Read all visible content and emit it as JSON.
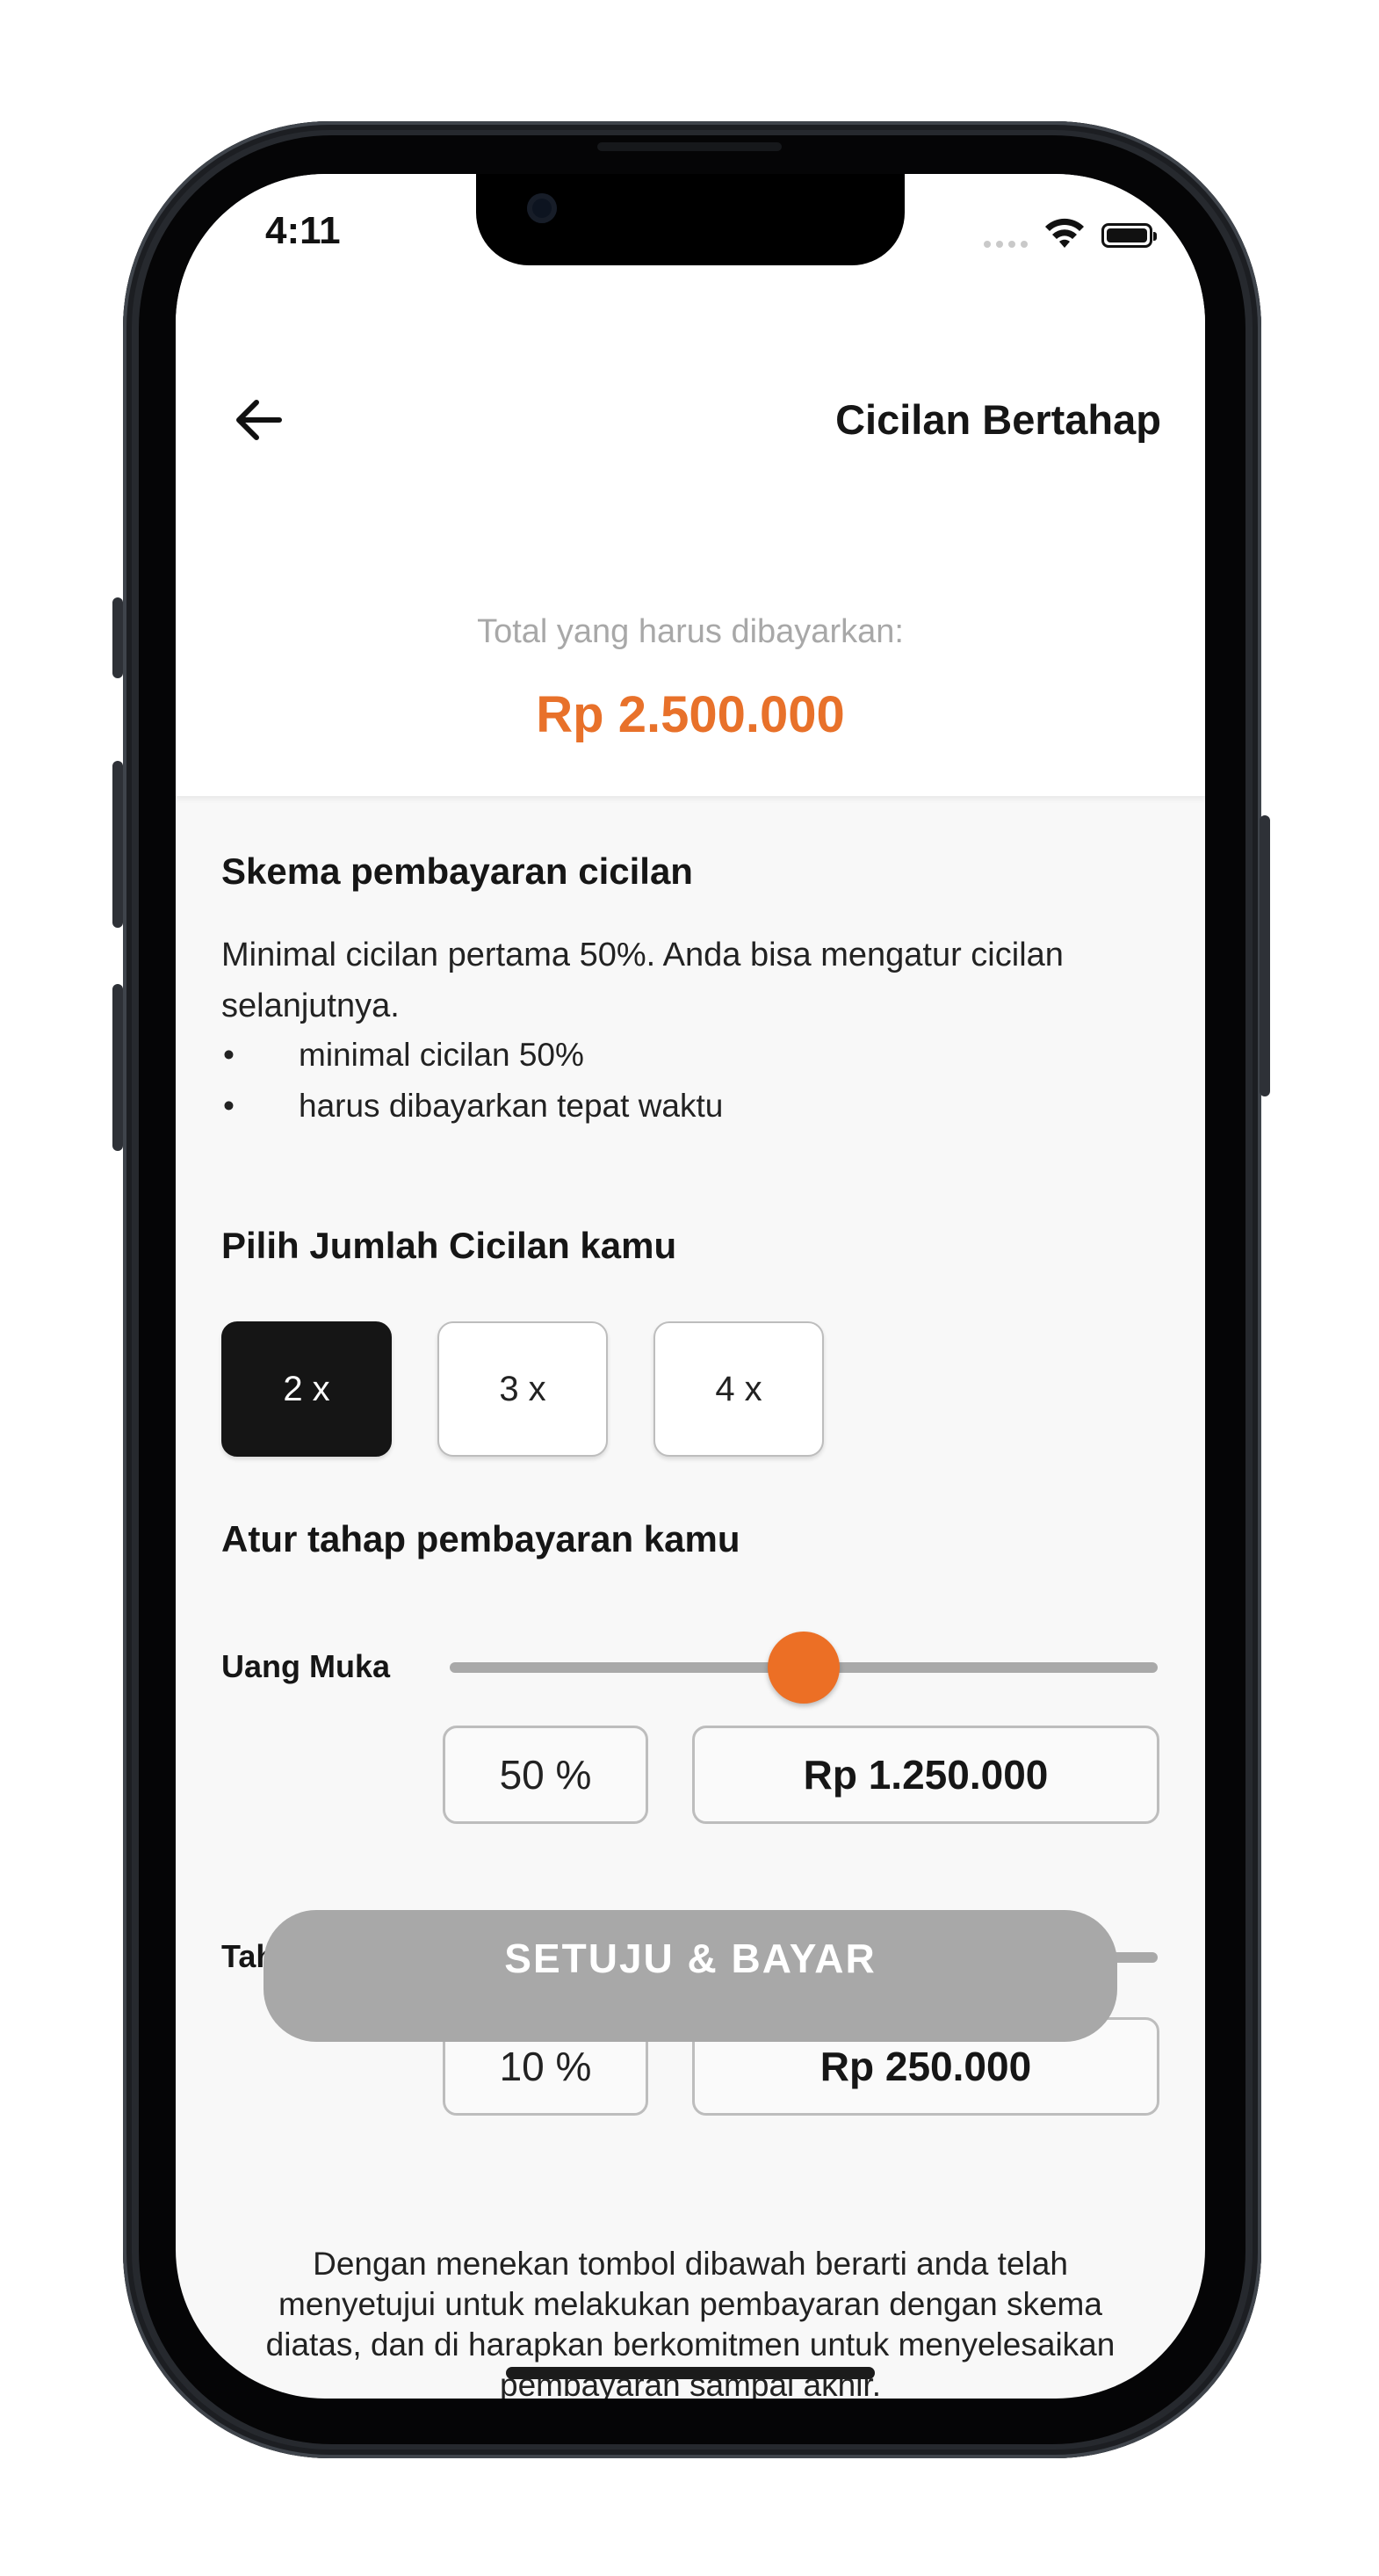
{
  "status_bar": {
    "time": "4:11"
  },
  "header": {
    "title": "Cicilan Bertahap",
    "total_label": "Total yang harus dibayarkan:",
    "total_amount": "Rp 2.500.000"
  },
  "scheme": {
    "title": "Skema pembayaran cicilan",
    "description": "Minimal cicilan pertama 50%. Anda bisa mengatur cicilan selanjutnya.",
    "bullets": [
      "minimal cicilan 50%",
      "harus dibayarkan tepat waktu"
    ]
  },
  "count_section": {
    "title": "Pilih Jumlah Cicilan kamu",
    "options": [
      "2 x",
      "3 x",
      "4 x"
    ],
    "selected": "2 x"
  },
  "stages_section": {
    "title": "Atur tahap pembayaran kamu",
    "stages": [
      {
        "label": "Uang Muka",
        "percent_text": "50 %",
        "amount": "Rp 1.250.000",
        "slider_value": 0.5
      },
      {
        "label": "Tahap 1",
        "percent_text": "10 %",
        "amount": "Rp 250.000",
        "slider_value": 0.13
      }
    ]
  },
  "agreement_text": "Dengan menekan tombol dibawah berarti anda telah menyetujui untuk melakukan pembayaran dengan skema diatas, dan di harapkan berkomitmen untuk menyelesaikan pembayaran sampai akhir.",
  "pay_button_label": "SETUJU & BAYAR",
  "colors": {
    "accent": "#E8712A",
    "selected_bg": "#151515",
    "disabled_button": "#A8A8A8"
  },
  "icons": {
    "back": "arrow-left-icon",
    "wifi": "wifi-icon",
    "battery": "battery-icon"
  }
}
